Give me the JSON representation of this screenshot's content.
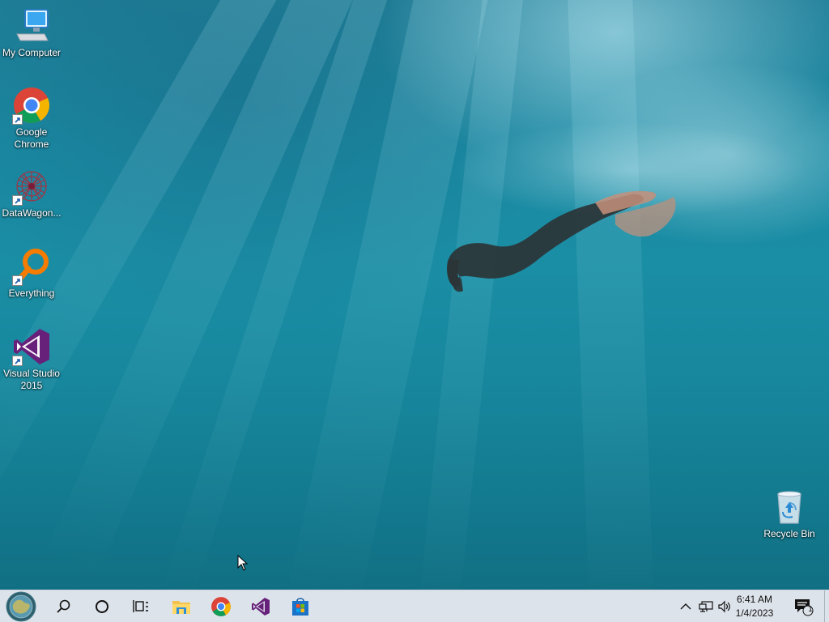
{
  "desktop": {
    "icons": [
      {
        "label": "My Computer",
        "icon": "monitor-icon"
      },
      {
        "label": "Google Chrome",
        "icon": "chrome-icon"
      },
      {
        "label": "DataWagon...",
        "icon": "datawagon-icon"
      },
      {
        "label": "Everything",
        "icon": "everything-search-icon"
      },
      {
        "label": "Visual Studio 2015",
        "icon": "visual-studio-icon"
      },
      {
        "label": "Recycle Bin",
        "icon": "recycle-bin-icon"
      }
    ]
  },
  "taskbar": {
    "pinned": [
      "start-orb-icon",
      "search-icon",
      "cortana-icon",
      "task-view-icon",
      "file-explorer-icon",
      "chrome-icon",
      "visual-studio-icon",
      "store-icon"
    ],
    "tray": [
      "chevron-up-icon",
      "network-icon",
      "volume-icon"
    ],
    "clock": {
      "time": "6:41 AM",
      "date": "1/4/2023"
    },
    "notifications": {
      "count": "1"
    }
  },
  "colors": {
    "accent": "#68217a",
    "taskbar": "#dde3ea",
    "water": "#1a8ea5"
  }
}
